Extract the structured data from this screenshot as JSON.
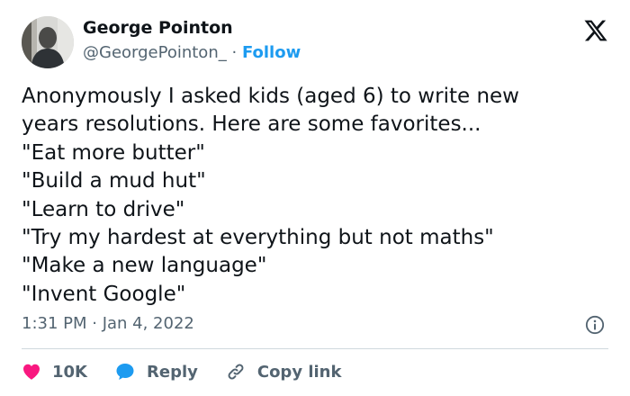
{
  "author": {
    "name": "George Pointon",
    "handle": "@GeorgePointon_",
    "separator": "·",
    "follow_label": "Follow"
  },
  "tweet": {
    "text": "Anonymously I asked kids (aged 6) to write new\nyears resolutions. Here are some favorites...\n\"Eat more butter\"\n\"Build a mud hut\"\n\"Learn to drive\"\n\"Try my hardest at everything but not maths\"\n\"Make a new language\"\n\"Invent Google\"",
    "timestamp": "1:31 PM · Jan 4, 2022"
  },
  "actions": {
    "like_count": "10K",
    "reply_label": "Reply",
    "copy_link_label": "Copy link"
  },
  "icons": {
    "logo": "x-logo-icon",
    "info": "info-icon",
    "like": "heart-icon",
    "reply": "speech-bubble-icon",
    "copy_link": "link-icon"
  },
  "colors": {
    "text": "#0f1419",
    "secondary": "#536471",
    "accent": "#1d9bf0",
    "like": "#f91880",
    "divider": "#cfd9de"
  }
}
